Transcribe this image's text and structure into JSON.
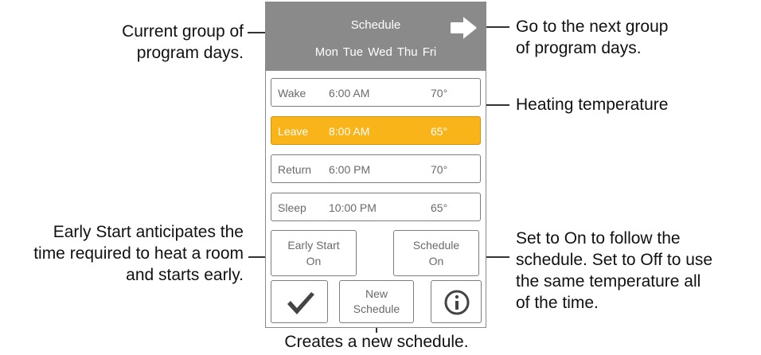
{
  "header": {
    "title": "Schedule",
    "days": "Mon Tue Wed Thu Fri"
  },
  "schedule_rows": [
    {
      "period": "Wake",
      "time": "6:00 AM",
      "temp": "70°",
      "active": false
    },
    {
      "period": "Leave",
      "time": "8:00 AM",
      "temp": "65°",
      "active": true
    },
    {
      "period": "Return",
      "time": "6:00 PM",
      "temp": "70°",
      "active": false
    },
    {
      "period": "Sleep",
      "time": "10:00 PM",
      "temp": "65°",
      "active": false
    }
  ],
  "toggles": {
    "early_start": {
      "label": "Early Start",
      "state": "On"
    },
    "schedule": {
      "label": "Schedule",
      "state": "On"
    }
  },
  "bottom": {
    "new_schedule": {
      "line1": "New",
      "line2": "Schedule"
    }
  },
  "icons": {
    "next": "arrow-right-icon",
    "confirm": "checkmark-icon",
    "info": "info-icon"
  },
  "colors": {
    "header_bg": "#8a8a8a",
    "active_row": "#f8b418",
    "border": "#7d7d7d"
  },
  "annotations": {
    "current_group": {
      "line1": "Current group of",
      "line2": "program days."
    },
    "next_group": {
      "line1": "Go to the next group",
      "line2": "of program days."
    },
    "heating_temp": "Heating temperature",
    "early_start": {
      "line1": "Early Start anticipates the",
      "line2": "time required to heat a room",
      "line3": "and starts early."
    },
    "schedule_toggle": {
      "line1": "Set to On to follow the",
      "line2": "schedule. Set to Off to use",
      "line3": "the same temperature all",
      "line4": "of the time."
    },
    "new_schedule": "Creates a new schedule."
  }
}
